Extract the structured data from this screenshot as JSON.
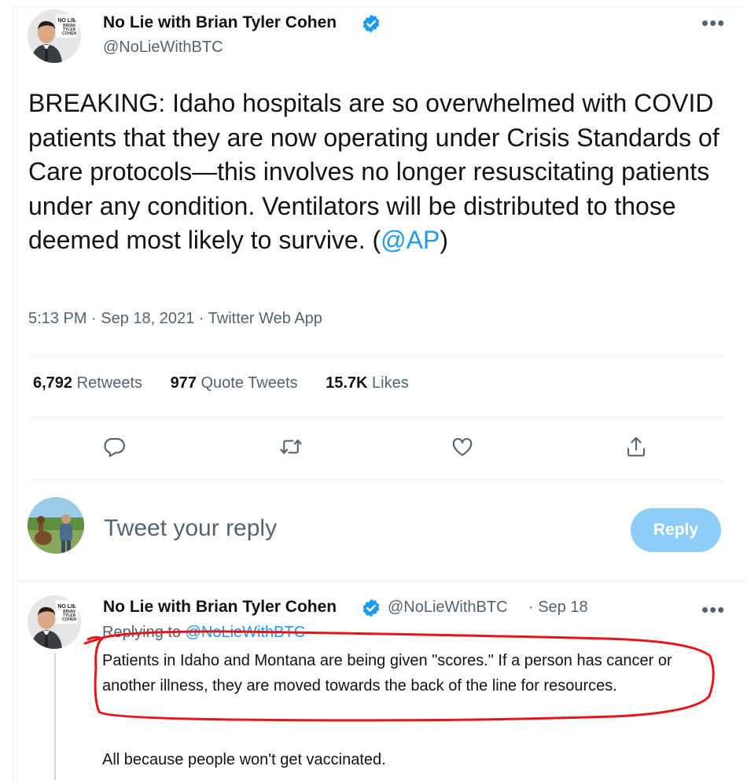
{
  "main_tweet": {
    "author_name": "No Lie with Brian Tyler Cohen",
    "author_handle": "@NoLieWithBTC",
    "text_before_link": "BREAKING: Idaho hospitals are so overwhelmed with COVID patients that they are now operating under Crisis Standards of Care protocols—this involves no longer resuscitating patients under any condition. Ventilators will be distributed to those deemed most likely to survive. (",
    "link": "@AP",
    "text_after_link": ")",
    "timestamp": "5:13 PM · Sep 18, 2021 · Twitter Web App",
    "more_label": "•••"
  },
  "stats": {
    "retweets_count": "6,792",
    "retweets_label": "Retweets",
    "quotes_count": "977",
    "quotes_label": "Quote Tweets",
    "likes_count": "15.7K",
    "likes_label": "Likes"
  },
  "reply_box": {
    "placeholder": "Tweet your reply",
    "button_label": "Reply"
  },
  "avatar_logo": {
    "line1": "NO LIE",
    "line2": "BRIAN",
    "line3": "TYLER",
    "line4": "COHEN"
  },
  "reply_tweet": {
    "author_name": "No Lie with Brian Tyler Cohen",
    "author_handle": "@NoLieWithBTC",
    "date": "· Sep 18",
    "replying_to_label": "Replying to",
    "replying_to_handle": "@NoLieWithBTC",
    "text_p1": "Patients in Idaho and Montana are being given \"scores.\" If a person has cancer or another illness, they are moved towards the back of the line for resources.",
    "text_p2": "All because people won't get vaccinated.",
    "more_label": "•••"
  },
  "colors": {
    "accent": "#1d9bf0",
    "annotation": "#e8141b",
    "reply_button_disabled": "#8ecdf8"
  }
}
